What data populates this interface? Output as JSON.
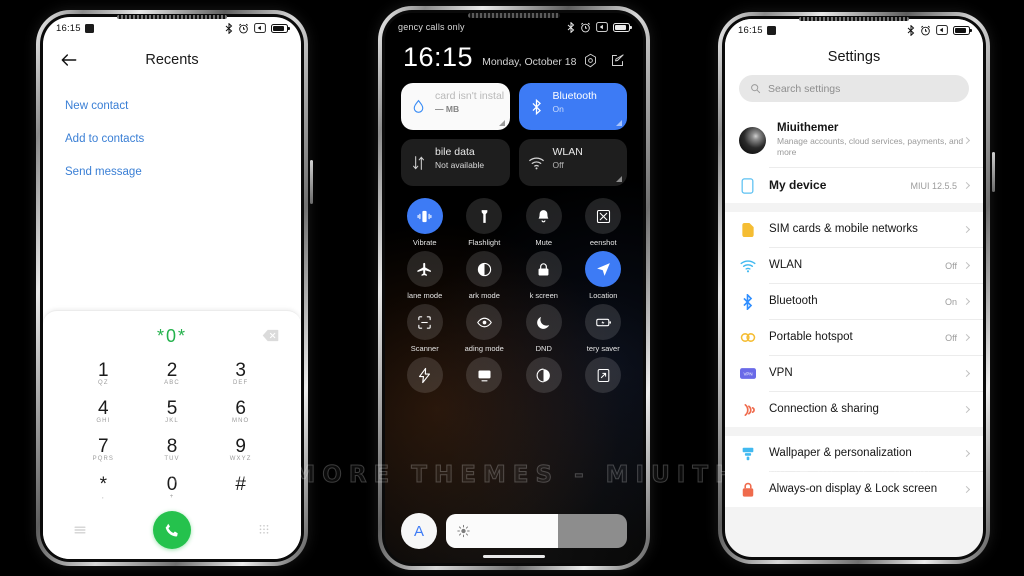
{
  "watermark": "VISIT FOR MORE THEMES - MIUITHEMER.COM",
  "phone1": {
    "status": {
      "time": "16:15"
    },
    "header": {
      "title": "Recents",
      "back_icon": "back-arrow-icon"
    },
    "actions": [
      {
        "label": "New contact"
      },
      {
        "label": "Add to contacts"
      },
      {
        "label": "Send message"
      }
    ],
    "dialer": {
      "number": "*0*",
      "keys": [
        {
          "digit": "1",
          "letters": "QZ"
        },
        {
          "digit": "2",
          "letters": "ABC"
        },
        {
          "digit": "3",
          "letters": "DEF"
        },
        {
          "digit": "4",
          "letters": "GHI"
        },
        {
          "digit": "5",
          "letters": "JKL"
        },
        {
          "digit": "6",
          "letters": "MNO"
        },
        {
          "digit": "7",
          "letters": "PQRS"
        },
        {
          "digit": "8",
          "letters": "TUV"
        },
        {
          "digit": "9",
          "letters": "WXYZ"
        },
        {
          "digit": "*",
          "letters": ","
        },
        {
          "digit": "0",
          "letters": "+"
        },
        {
          "digit": "#",
          "letters": ""
        }
      ],
      "menu_icon": "hamburger-menu-icon",
      "call_icon": "phone-call-icon",
      "keypad_icon": "dialpad-icon",
      "backspace_icon": "backspace-icon"
    }
  },
  "phone2": {
    "status": {
      "carrier": "gency calls only"
    },
    "clock": {
      "time": "16:15",
      "date": "Monday, October 18"
    },
    "header_icons": [
      {
        "name": "settings-gear-icon"
      },
      {
        "name": "edit-pencil-icon"
      }
    ],
    "big_tiles": [
      {
        "title": "card isn't instal",
        "sub": "— MB",
        "icon": "data-usage-drop-icon",
        "style": "light"
      },
      {
        "title": "Bluetooth",
        "sub": "On",
        "icon": "bluetooth-icon",
        "style": "blue"
      },
      {
        "title": "bile data",
        "sub": "Not available",
        "icon": "mobile-data-icon",
        "style": "dark"
      },
      {
        "title": "WLAN",
        "sub": "Off",
        "icon": "wifi-icon",
        "style": "dark"
      }
    ],
    "toggles": [
      {
        "label": "Vibrate",
        "icon": "vibrate-icon",
        "on": true
      },
      {
        "label": "Flashlight",
        "icon": "flashlight-icon",
        "on": false
      },
      {
        "label": "Mute",
        "icon": "bell-mute-icon",
        "on": false
      },
      {
        "label": "eenshot",
        "icon": "screenshot-icon",
        "on": false
      },
      {
        "label": "lane mode",
        "icon": "airplane-icon",
        "on": false
      },
      {
        "label": "ark mode",
        "icon": "dark-mode-icon",
        "on": false
      },
      {
        "label": "k screen",
        "icon": "lock-screen-icon",
        "on": false
      },
      {
        "label": "Location",
        "icon": "location-arrow-icon",
        "on": true
      },
      {
        "label": "Scanner",
        "icon": "scanner-icon",
        "on": false
      },
      {
        "label": "ading mode",
        "icon": "reading-mode-eye-icon",
        "on": false
      },
      {
        "label": "DND",
        "icon": "moon-dnd-icon",
        "on": false
      },
      {
        "label": "tery saver",
        "icon": "battery-saver-icon",
        "on": false
      },
      {
        "label": "",
        "icon": "lightning-bolt-icon",
        "on": false
      },
      {
        "label": "",
        "icon": "cast-screen-icon",
        "on": false
      },
      {
        "label": "",
        "icon": "sync-icon",
        "on": false
      },
      {
        "label": "",
        "icon": "auto-rotate-icon",
        "on": false
      }
    ],
    "brightness": {
      "auto_label": "A",
      "fill_percent": 62,
      "sun_icon": "brightness-sun-icon"
    }
  },
  "phone3": {
    "status": {
      "time": "16:15"
    },
    "title": "Settings",
    "search": {
      "placeholder": "Search settings",
      "icon": "search-icon"
    },
    "account": {
      "name": "Miuithemer",
      "subtitle": "Manage accounts, cloud services, payments, and more"
    },
    "device": {
      "label": "My device",
      "value": "MIUI 12.5.5",
      "icon": "device-phone-icon"
    },
    "group1": [
      {
        "label": "SIM cards & mobile networks",
        "value": "",
        "icon": "sim-card-icon",
        "color": "#f5bd33"
      },
      {
        "label": "WLAN",
        "value": "Off",
        "icon": "wifi-icon",
        "color": "#41b9f0"
      },
      {
        "label": "Bluetooth",
        "value": "On",
        "icon": "bluetooth-icon",
        "color": "#2f8eff"
      },
      {
        "label": "Portable hotspot",
        "value": "Off",
        "icon": "hotspot-icon",
        "color": "#f5bd33"
      },
      {
        "label": "VPN",
        "value": "",
        "icon": "vpn-icon",
        "color": "#6a6ae8"
      },
      {
        "label": "Connection & sharing",
        "value": "",
        "icon": "connection-sharing-icon",
        "color": "#ef6b4d"
      }
    ],
    "group2": [
      {
        "label": "Wallpaper & personalization",
        "value": "",
        "icon": "wallpaper-icon",
        "color": "#41b9f0"
      },
      {
        "label": "Always-on display & Lock screen",
        "value": "",
        "icon": "lock-icon",
        "color": "#ef6b4d"
      }
    ]
  }
}
